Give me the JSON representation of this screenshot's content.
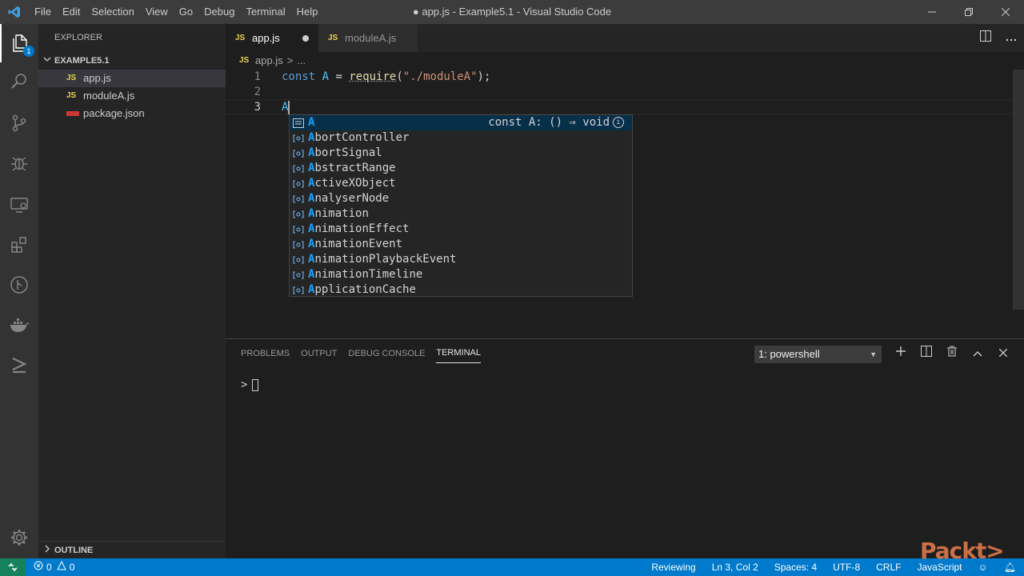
{
  "titlebar": {
    "menu": [
      "File",
      "Edit",
      "Selection",
      "View",
      "Go",
      "Debug",
      "Terminal",
      "Help"
    ],
    "title": "● app.js - Example5.1 - Visual Studio Code"
  },
  "activitybar": {
    "explorer_badge": "1"
  },
  "sidebar": {
    "header": "EXPLORER",
    "folder": "EXAMPLE5.1",
    "files": [
      {
        "name": "app.js",
        "badge": "JS"
      },
      {
        "name": "moduleA.js",
        "badge": "JS"
      },
      {
        "name": "package.json",
        "badge": ""
      }
    ],
    "outline": "OUTLINE"
  },
  "tabs": [
    {
      "label": "app.js",
      "badge": "JS"
    },
    {
      "label": "moduleA.js",
      "badge": "JS"
    }
  ],
  "breadcrumb": {
    "file": "app.js",
    "sep": ">",
    "rest": "..."
  },
  "editor": {
    "line_numbers": [
      "1",
      "2",
      "3"
    ],
    "line1": {
      "kw": "const",
      "var": "A",
      "eq": "=",
      "fn": "require",
      "open": "(",
      "str": "\"./moduleA\"",
      "close": ");"
    },
    "line3": "A"
  },
  "suggest": {
    "items": [
      {
        "hl": "A",
        "rest": "",
        "detail": "const A: () ⇒ void"
      },
      {
        "hl": "A",
        "rest": "bortController"
      },
      {
        "hl": "A",
        "rest": "bortSignal"
      },
      {
        "hl": "A",
        "rest": "bstractRange"
      },
      {
        "hl": "A",
        "rest": "ctiveXObject"
      },
      {
        "hl": "A",
        "rest": "nalyserNode"
      },
      {
        "hl": "A",
        "rest": "nimation"
      },
      {
        "hl": "A",
        "rest": "nimationEffect"
      },
      {
        "hl": "A",
        "rest": "nimationEvent"
      },
      {
        "hl": "A",
        "rest": "nimationPlaybackEvent"
      },
      {
        "hl": "A",
        "rest": "nimationTimeline"
      },
      {
        "hl": "A",
        "rest": "pplicationCache"
      }
    ],
    "info": "i"
  },
  "panel": {
    "tabs": [
      "PROBLEMS",
      "OUTPUT",
      "DEBUG CONSOLE",
      "TERMINAL"
    ],
    "terminal_select": "1: powershell",
    "prompt": ">"
  },
  "statusbar": {
    "errors": "0",
    "warnings": "0",
    "right": [
      "Reviewing",
      "Ln 3, Col 2",
      "Spaces: 4",
      "UTF-8",
      "CRLF",
      "JavaScript"
    ]
  },
  "watermark": "Packt>",
  "colors": {
    "accent": "#007acc",
    "js_badge": "#e8d44d",
    "match_highlight": "#18a3ff"
  }
}
